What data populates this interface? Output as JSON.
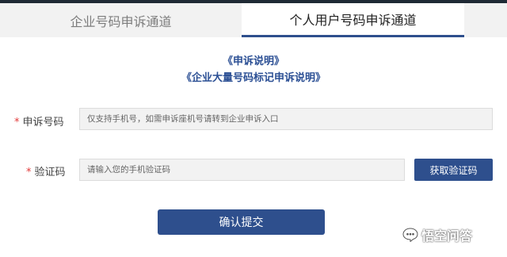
{
  "tabs": [
    {
      "label": "企业号码申诉通道",
      "active": false
    },
    {
      "label": "个人用户号码申诉通道",
      "active": true
    }
  ],
  "links": {
    "appeal_notes": "《申诉说明》",
    "enterprise_bulk_notes": "《企业大量号码标记申诉说明》"
  },
  "form": {
    "required_mark": "*",
    "phone_label": "申诉号码",
    "phone_placeholder": "仅支持手机号，如需申诉座机号请转到企业申诉入口",
    "code_label": "验证码",
    "code_placeholder": "请输入您的手机验证码",
    "get_code_label": "获取验证码",
    "submit_label": "确认提交"
  },
  "watermark": {
    "text": "悟空问答",
    "icon": "chat-bubble-icon"
  },
  "colors": {
    "accent": "#2e4f8d",
    "required": "#e23a3a",
    "link": "#2b4f94"
  }
}
